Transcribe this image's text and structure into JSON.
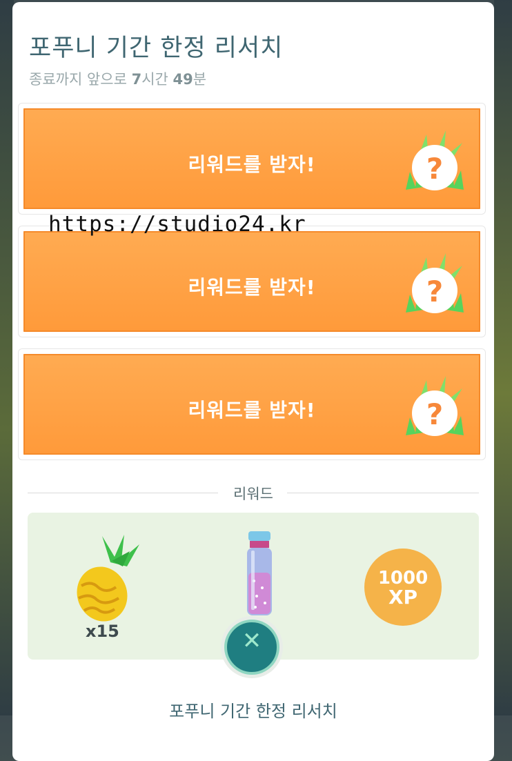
{
  "header": {
    "title": "포푸니 기간 한정 리서치",
    "subtitle_prefix": "종료까지 앞으로 ",
    "hours_value": "7",
    "hours_unit": "시간 ",
    "minutes_value": "49",
    "minutes_unit": "분"
  },
  "tasks": [
    {
      "label": "리워드를 받자!",
      "badge": "?"
    },
    {
      "label": "리워드를 받자!",
      "badge": "?"
    },
    {
      "label": "리워드를 받자!",
      "badge": "?"
    }
  ],
  "rewards_section": {
    "heading": "리워드",
    "pinap_quantity": "x15",
    "xp_amount": "1000",
    "xp_unit": "XP"
  },
  "close_button": {
    "icon": "close-x-icon",
    "glyph": "✕"
  },
  "footer": {
    "title": "포푸니 기간 한정 리서치"
  },
  "watermark": "https://studio24.kr",
  "colors": {
    "task_orange": "#ff9f43",
    "title_teal": "#3f6671",
    "reward_bg": "#e9f3e3",
    "xp_gold": "#f5b349",
    "close_teal": "#1f7e81"
  }
}
